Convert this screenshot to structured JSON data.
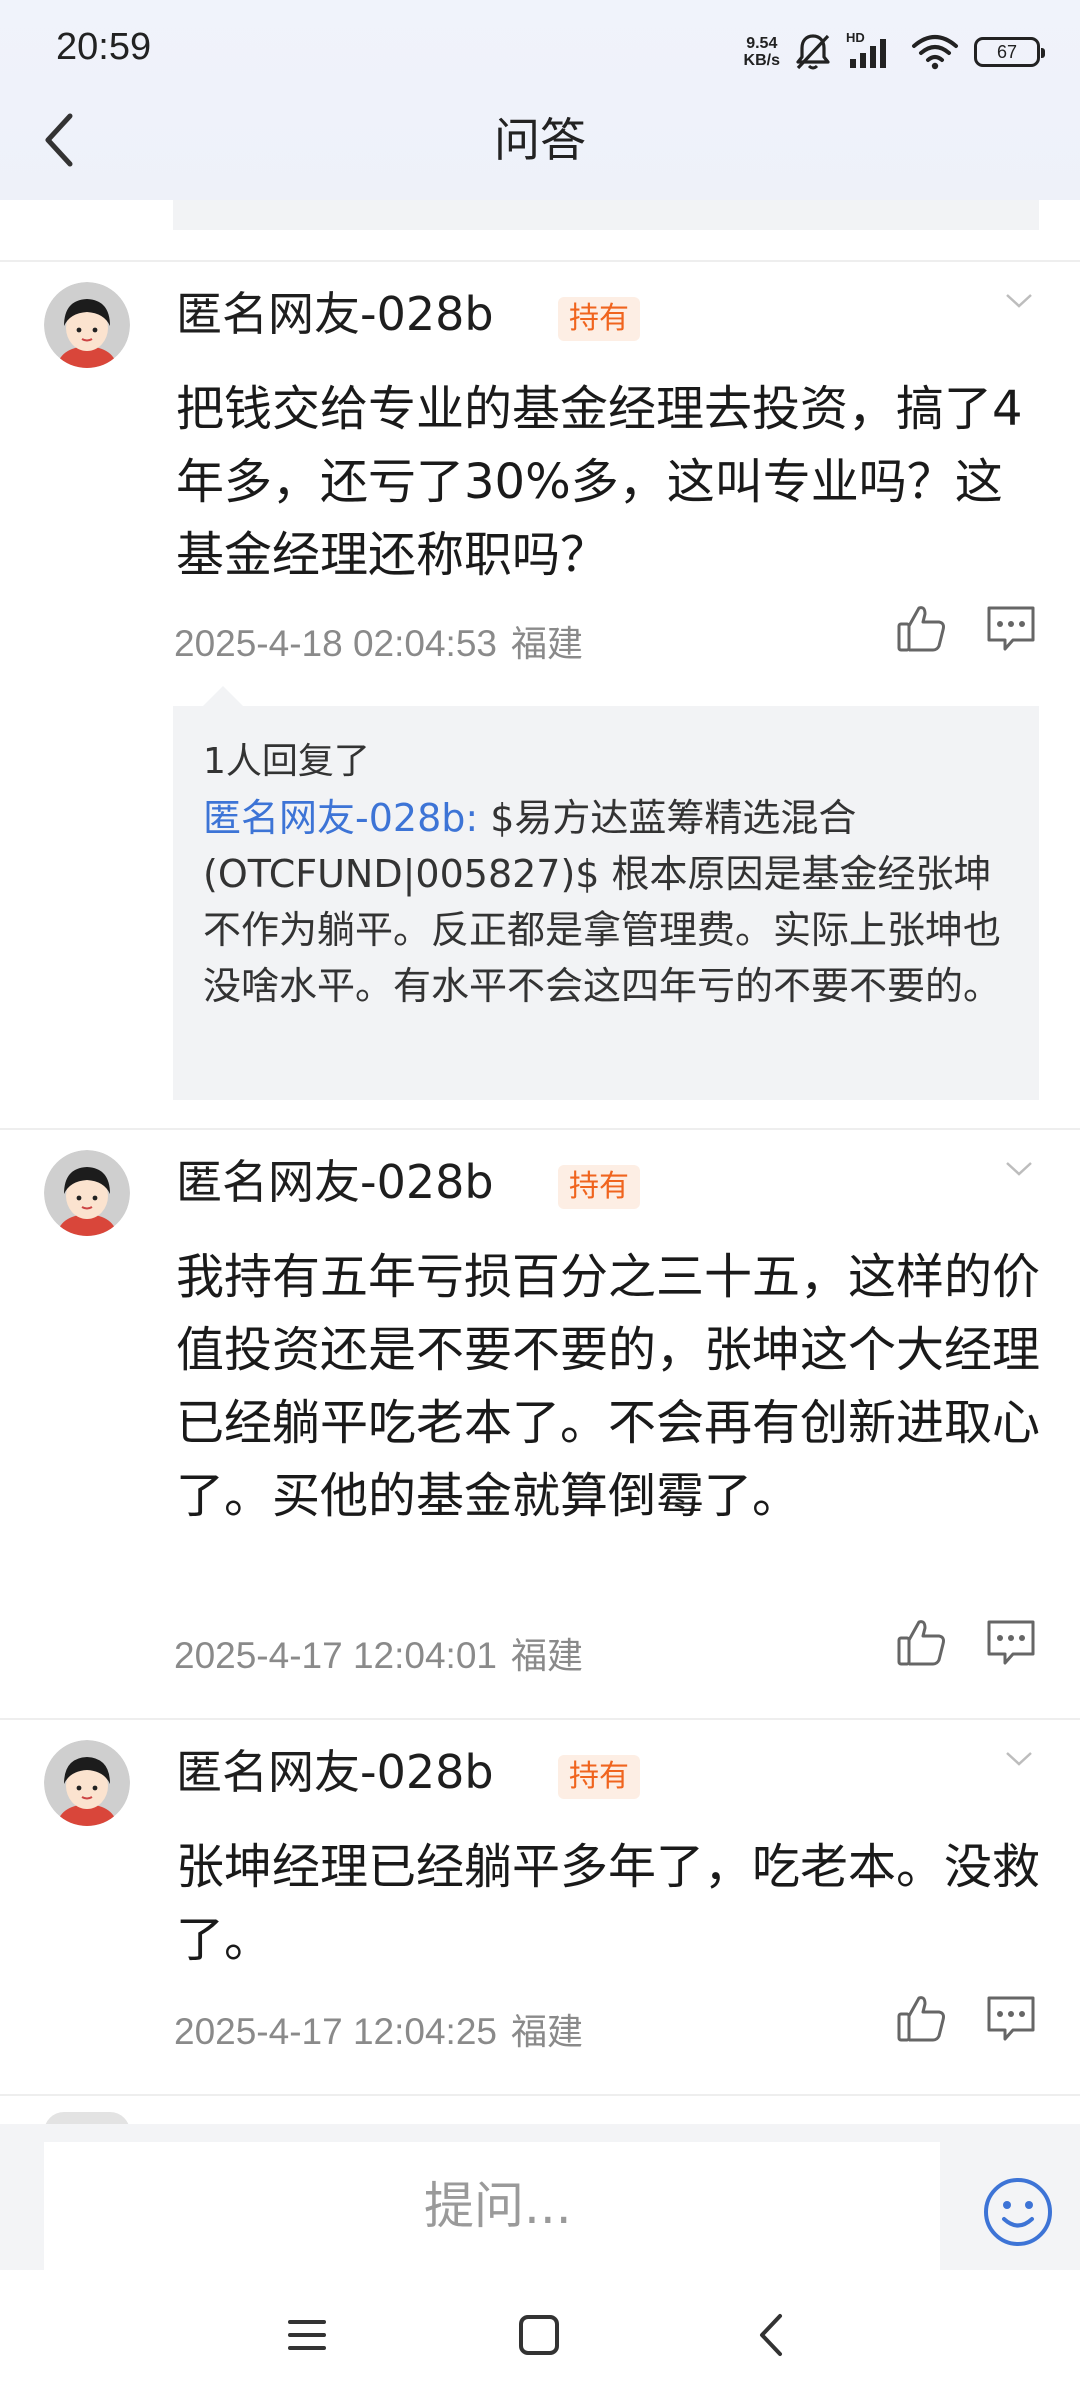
{
  "status_bar": {
    "time": "20:59",
    "net_speed_value": "9.54",
    "net_speed_unit": "KB/s",
    "network_type": "HD",
    "battery": "67",
    "icons": [
      "mute-bell-icon",
      "signal-icon",
      "wifi-icon",
      "battery-icon"
    ]
  },
  "header": {
    "title": "问答",
    "back_icon": "chevron-left-icon"
  },
  "comments": [
    {
      "author": "匿名网友-028b",
      "badge": "持有",
      "text": "把钱交给专业的基金经理去投资，搞了4年多，还亏了30%多，这叫专业吗？这基金经理还称职吗？",
      "time": "2025-4-18 02:04:53",
      "location": "福建",
      "replies": {
        "count_text": "1人回复了",
        "author": "匿名网友-028b:",
        "text": " $易方达蓝筹精选混合(OTCFUND|005827)$ 根本原因是基金经张坤不作为躺平。反正都是拿管理费。实际上张坤也没啥水平。有水平不会这四年亏的不要不要的。"
      }
    },
    {
      "author": "匿名网友-028b",
      "badge": "持有",
      "text": "我持有五年亏损百分之三十五，这样的价值投资还是不要不要的，张坤这个大经理已经躺平吃老本了。不会再有创新进取心了。买他的基金就算倒霉了。",
      "time": "2025-4-17 12:04:01",
      "location": "福建"
    },
    {
      "author": "匿名网友-028b",
      "badge": "持有",
      "text": "张坤经理已经躺平多年了，吃老本。没救了。",
      "time": "2025-4-17 12:04:25",
      "location": "福建"
    }
  ],
  "input": {
    "placeholder": "提问..."
  },
  "accent_colors": {
    "badge_text": "#f0641e",
    "badge_bg": "#fdeee4",
    "link": "#3d74d6",
    "emoji": "#3d74d6"
  }
}
